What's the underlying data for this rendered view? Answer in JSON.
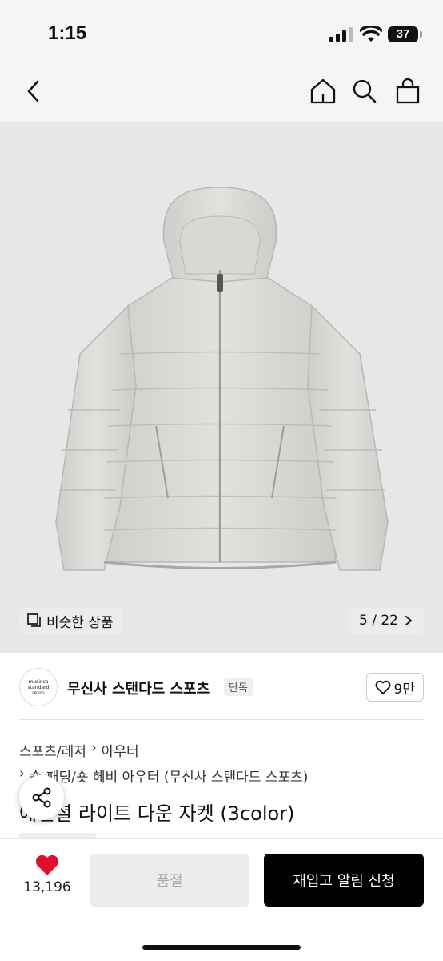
{
  "status": {
    "time": "1:15",
    "battery": "37"
  },
  "product": {
    "similar_label": "비슷한 상품",
    "image_counter": "5 / 22",
    "brand_name": "무신사 스탠다드 스포츠",
    "brand_badge": "단독",
    "brand_logo_lines": [
      "musinsa",
      "standard",
      "SPORTS"
    ],
    "likes_short": "9만",
    "breadcrumb": [
      "스포츠/레저",
      "아우터"
    ],
    "subcategory": "숏 패딩/숏 헤비 아우터 (무신사 스탠다드 스포츠)",
    "title": "에센셜 라이트 다운 자켓 (3color)",
    "tag": "무신사스탠다드"
  },
  "bottom": {
    "like_count": "13,196",
    "soldout_label": "품절",
    "restock_label": "재입고 알림 신청"
  },
  "colors": {
    "accent_red": "#e0102c",
    "primary_black": "#000000",
    "image_bg": "#e7e7e9"
  }
}
